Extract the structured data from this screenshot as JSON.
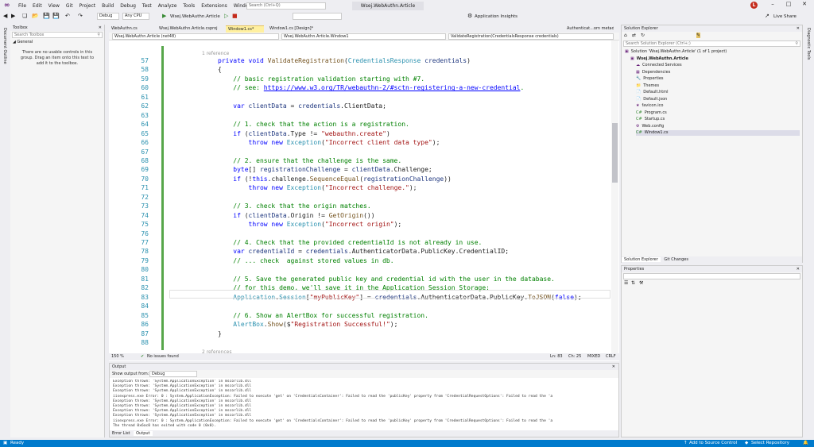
{
  "menu": {
    "items": [
      "File",
      "Edit",
      "View",
      "Git",
      "Project",
      "Build",
      "Debug",
      "Test",
      "Analyze",
      "Tools",
      "Extensions",
      "Window",
      "Help"
    ],
    "search_placeholder": "Search (Ctrl+Q)",
    "project_title": "Wsej.WebAuthn.Article",
    "avatar_initial": "L"
  },
  "toolbar": {
    "config": "Debug",
    "platform": "Any CPU",
    "run_target": "Wsej.WebAuthn.Article",
    "app_insights": "Application Insights",
    "live_share": "Live Share"
  },
  "left_strip": {
    "label": "Document Outline"
  },
  "toolbox": {
    "title": "Toolbox",
    "search_placeholder": "Search Toolbox",
    "group": "General",
    "empty_message": "There are no usable controls in this group. Drag an item onto this text to add it to the toolbox."
  },
  "doc_tabs": [
    "WebAuthn.cs",
    "Wsej.WebAuthn.Article.csproj",
    "Window1.cs*",
    "Window1.cs [Design]*",
    "Authenticat...orn metadata]"
  ],
  "navbar": {
    "project": "Wsej.WebAuthn.Article (net48)",
    "class": "Wsej.WebAuthn.Article.Window1",
    "member": "ValidateRegistration(CredentialsResponse credentials)"
  },
  "code": {
    "ref_top": "1 reference",
    "ref_bottom": "2 references",
    "lines": [
      {
        "n": "57",
        "segs": [
          [
            "k",
            "private void "
          ],
          [
            "m",
            "ValidateRegistration"
          ],
          [
            "",
            "("
          ],
          [
            "t",
            "CredentialsResponse"
          ],
          [
            "",
            " "
          ],
          [
            "v",
            "credentials"
          ],
          [
            "",
            ")"
          ]
        ]
      },
      {
        "n": "58",
        "segs": [
          [
            "",
            "{"
          ]
        ]
      },
      {
        "n": "59",
        "segs": [
          [
            "",
            "    "
          ],
          [
            "c",
            "// basic registration validation starting with #7."
          ]
        ]
      },
      {
        "n": "60",
        "segs": [
          [
            "",
            "    "
          ],
          [
            "c",
            "// see: "
          ],
          [
            "u",
            "https://www.w3.org/TR/webauthn-2/#sctn-registering-a-new-credential"
          ],
          [
            "c",
            "."
          ]
        ]
      },
      {
        "n": "61",
        "segs": []
      },
      {
        "n": "62",
        "segs": [
          [
            "",
            "    "
          ],
          [
            "k",
            "var "
          ],
          [
            "v",
            "clientData"
          ],
          [
            "",
            " = "
          ],
          [
            "v",
            "credentials"
          ],
          [
            "",
            ".ClientData;"
          ]
        ]
      },
      {
        "n": "63",
        "segs": []
      },
      {
        "n": "64",
        "segs": [
          [
            "",
            "    "
          ],
          [
            "c",
            "// 1. check that the action is a registration."
          ]
        ]
      },
      {
        "n": "65",
        "segs": [
          [
            "",
            "    "
          ],
          [
            "k",
            "if "
          ],
          [
            "",
            "("
          ],
          [
            "v",
            "clientData"
          ],
          [
            "",
            ".Type != "
          ],
          [
            "s",
            "\"webauthn.create\""
          ],
          [
            "",
            ")"
          ]
        ]
      },
      {
        "n": "66",
        "segs": [
          [
            "",
            "        "
          ],
          [
            "k",
            "throw new "
          ],
          [
            "t",
            "Exception"
          ],
          [
            "",
            "("
          ],
          [
            "s",
            "\"Incorrect client data type\""
          ],
          [
            "",
            ");"
          ]
        ]
      },
      {
        "n": "67",
        "segs": []
      },
      {
        "n": "68",
        "segs": [
          [
            "",
            "    "
          ],
          [
            "c",
            "// 2. ensure that the challenge is the same."
          ]
        ]
      },
      {
        "n": "69",
        "segs": [
          [
            "",
            "    "
          ],
          [
            "k",
            "byte"
          ],
          [
            "",
            "[] "
          ],
          [
            "v",
            "registrationChallenge"
          ],
          [
            "",
            " = "
          ],
          [
            "v",
            "clientData"
          ],
          [
            "",
            ".Challenge;"
          ]
        ]
      },
      {
        "n": "70",
        "segs": [
          [
            "",
            "    "
          ],
          [
            "k",
            "if "
          ],
          [
            "",
            "(!"
          ],
          [
            "k",
            "this"
          ],
          [
            "",
            ".challenge."
          ],
          [
            "m",
            "SequenceEqual"
          ],
          [
            "",
            "("
          ],
          [
            "v",
            "registrationChallenge"
          ],
          [
            "",
            "))"
          ]
        ]
      },
      {
        "n": "71",
        "segs": [
          [
            "",
            "        "
          ],
          [
            "k",
            "throw new "
          ],
          [
            "t",
            "Exception"
          ],
          [
            "",
            "("
          ],
          [
            "s",
            "\"Incorrect challenge.\""
          ],
          [
            "",
            ");"
          ]
        ]
      },
      {
        "n": "72",
        "segs": []
      },
      {
        "n": "73",
        "segs": [
          [
            "",
            "    "
          ],
          [
            "c",
            "// 3. check that the origin matches."
          ]
        ]
      },
      {
        "n": "74",
        "segs": [
          [
            "",
            "    "
          ],
          [
            "k",
            "if "
          ],
          [
            "",
            "("
          ],
          [
            "v",
            "clientData"
          ],
          [
            "",
            ".Origin != "
          ],
          [
            "m",
            "GetOrigin"
          ],
          [
            "",
            "())"
          ]
        ]
      },
      {
        "n": "75",
        "segs": [
          [
            "",
            "        "
          ],
          [
            "k",
            "throw new "
          ],
          [
            "t",
            "Exception"
          ],
          [
            "",
            "("
          ],
          [
            "s",
            "\"Incorrect origin\""
          ],
          [
            "",
            ");"
          ]
        ]
      },
      {
        "n": "76",
        "segs": []
      },
      {
        "n": "77",
        "segs": [
          [
            "",
            "    "
          ],
          [
            "c",
            "// 4. Check that the provided credentialId is not already in use."
          ]
        ]
      },
      {
        "n": "78",
        "segs": [
          [
            "",
            "    "
          ],
          [
            "k",
            "var "
          ],
          [
            "v",
            "credentialId"
          ],
          [
            "",
            " = "
          ],
          [
            "v",
            "credentials"
          ],
          [
            "",
            ".AuthenticatorData.PublicKey.CredentialID;"
          ]
        ]
      },
      {
        "n": "79",
        "segs": [
          [
            "",
            "    "
          ],
          [
            "c",
            "// ... check  against stored values in db."
          ]
        ]
      },
      {
        "n": "80",
        "segs": []
      },
      {
        "n": "81",
        "segs": [
          [
            "",
            "    "
          ],
          [
            "c",
            "// 5. Save the generated public key and credential id with the user in the database."
          ]
        ]
      },
      {
        "n": "82",
        "segs": [
          [
            "",
            "    "
          ],
          [
            "c",
            "// for this demo, we'll save it in the Application Session Storage:"
          ]
        ]
      },
      {
        "n": "83",
        "segs": [
          [
            "",
            "    "
          ],
          [
            "t",
            "Application"
          ],
          [
            "",
            "."
          ],
          [
            "t",
            "Session"
          ],
          [
            "",
            "["
          ],
          [
            "s",
            "\"myPublicKey\""
          ],
          [
            "",
            "] = "
          ],
          [
            "v",
            "credentials"
          ],
          [
            "",
            ".AuthenticatorData.PublicKey."
          ],
          [
            "m",
            "ToJSON"
          ],
          [
            "",
            "("
          ],
          [
            "k",
            "false"
          ],
          [
            "",
            ");"
          ]
        ]
      },
      {
        "n": "84",
        "segs": []
      },
      {
        "n": "85",
        "segs": [
          [
            "",
            "    "
          ],
          [
            "c",
            "// 6. Show an AlertBox for successful registration."
          ]
        ]
      },
      {
        "n": "86",
        "segs": [
          [
            "",
            "    "
          ],
          [
            "t",
            "AlertBox"
          ],
          [
            "",
            "."
          ],
          [
            "m",
            "Show"
          ],
          [
            "",
            "($"
          ],
          [
            "s",
            "\"Registration Successful!\""
          ],
          [
            "",
            ");"
          ]
        ]
      },
      {
        "n": "87",
        "segs": [
          [
            "",
            "}"
          ]
        ]
      },
      {
        "n": "88",
        "segs": []
      }
    ]
  },
  "editor_status": {
    "zoom": "150 %",
    "issues": "No issues found",
    "ln": "Ln: 83",
    "ch": "Ch: 25",
    "mode": "MIXED",
    "eol": "CRLF"
  },
  "output": {
    "title": "Output",
    "show_from_label": "Show output from:",
    "source": "Debug",
    "lines": [
      "Exception thrown: 'System.ApplicationException' in mscorlib.dll",
      "Exception thrown: 'System.ApplicationException' in mscorlib.dll",
      "Exception thrown: 'System.ApplicationException' in mscorlib.dll",
      "iisexpress.exe Error: 0 : System.ApplicationException: Failed to execute 'get' on 'CredentialsContainer': Failed to read the 'publicKey' property from 'CredentialRequestOptions': Failed to read the 'a",
      "Exception thrown: 'System.ApplicationException' in mscorlib.dll",
      "Exception thrown: 'System.ApplicationException' in mscorlib.dll",
      "Exception thrown: 'System.ApplicationException' in mscorlib.dll",
      "Exception thrown: 'System.ApplicationException' in mscorlib.dll",
      "iisexpress.exe Error: 0 : System.ApplicationException: Failed to execute 'get' on 'CredentialsContainer': Failed to read the 'publicKey' property from 'CredentialRequestOptions': Failed to read the 'a",
      "The thread 0x6ac0 has exited with code 0 (0x0)."
    ],
    "tabs": [
      "Error List",
      "Output"
    ]
  },
  "solution_explorer": {
    "title": "Solution Explorer",
    "search_placeholder": "Search Solution Explorer (Ctrl+;)",
    "items": [
      {
        "label": "Solution 'Wsej.WebAuthn.Article' (1 of 1 project)",
        "indent": 0,
        "bold": false
      },
      {
        "label": "Wsej.WebAuthn.Article",
        "indent": 1,
        "bold": true
      },
      {
        "label": "Connected Services",
        "indent": 2,
        "bold": false
      },
      {
        "label": "Dependencies",
        "indent": 2,
        "bold": false
      },
      {
        "label": "Properties",
        "indent": 2,
        "bold": false
      },
      {
        "label": "Themes",
        "indent": 2,
        "bold": false
      },
      {
        "label": "Default.html",
        "indent": 2,
        "bold": false
      },
      {
        "label": "Default.json",
        "indent": 2,
        "bold": false
      },
      {
        "label": "favicon.ico",
        "indent": 2,
        "bold": false
      },
      {
        "label": "Program.cs",
        "indent": 2,
        "bold": false
      },
      {
        "label": "Startup.cs",
        "indent": 2,
        "bold": false
      },
      {
        "label": "Web.config",
        "indent": 2,
        "bold": false
      },
      {
        "label": "Window1.cs",
        "indent": 2,
        "bold": false
      }
    ],
    "bottom_tabs": [
      "Solution Explorer",
      "Git Changes"
    ]
  },
  "properties": {
    "title": "Properties"
  },
  "right_strip": {
    "label": "Diagnostic Tools"
  },
  "statusbar": {
    "ready": "Ready",
    "source_control": "Add to Source Control",
    "repository": "Select Repository"
  },
  "colors": {
    "accent": "#007acc",
    "brand": "#68217a",
    "vs_green": "#57a64a"
  }
}
